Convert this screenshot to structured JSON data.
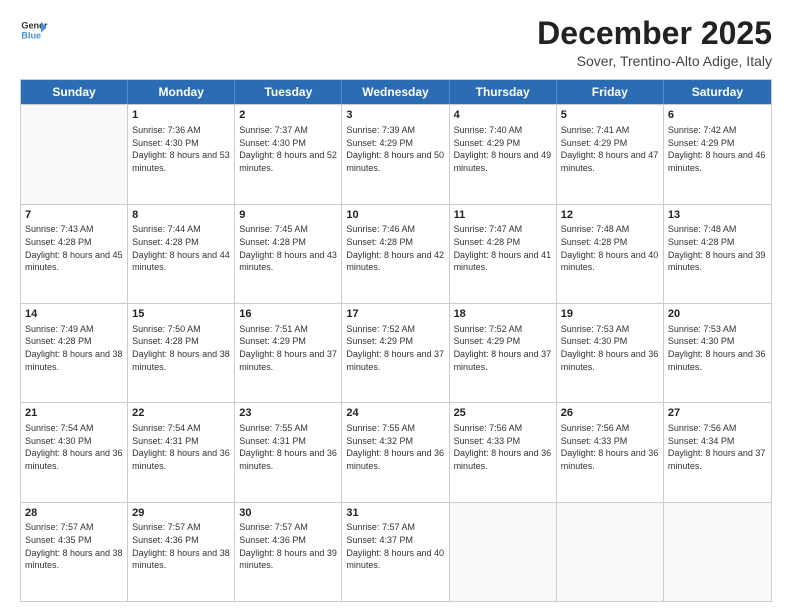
{
  "header": {
    "logo_line1": "General",
    "logo_line2": "Blue",
    "main_title": "December 2025",
    "subtitle": "Sover, Trentino-Alto Adige, Italy"
  },
  "days_of_week": [
    "Sunday",
    "Monday",
    "Tuesday",
    "Wednesday",
    "Thursday",
    "Friday",
    "Saturday"
  ],
  "weeks": [
    [
      {
        "day": "",
        "sunrise": "",
        "sunset": "",
        "daylight": ""
      },
      {
        "day": "1",
        "sunrise": "Sunrise: 7:36 AM",
        "sunset": "Sunset: 4:30 PM",
        "daylight": "Daylight: 8 hours and 53 minutes."
      },
      {
        "day": "2",
        "sunrise": "Sunrise: 7:37 AM",
        "sunset": "Sunset: 4:30 PM",
        "daylight": "Daylight: 8 hours and 52 minutes."
      },
      {
        "day": "3",
        "sunrise": "Sunrise: 7:39 AM",
        "sunset": "Sunset: 4:29 PM",
        "daylight": "Daylight: 8 hours and 50 minutes."
      },
      {
        "day": "4",
        "sunrise": "Sunrise: 7:40 AM",
        "sunset": "Sunset: 4:29 PM",
        "daylight": "Daylight: 8 hours and 49 minutes."
      },
      {
        "day": "5",
        "sunrise": "Sunrise: 7:41 AM",
        "sunset": "Sunset: 4:29 PM",
        "daylight": "Daylight: 8 hours and 47 minutes."
      },
      {
        "day": "6",
        "sunrise": "Sunrise: 7:42 AM",
        "sunset": "Sunset: 4:29 PM",
        "daylight": "Daylight: 8 hours and 46 minutes."
      }
    ],
    [
      {
        "day": "7",
        "sunrise": "Sunrise: 7:43 AM",
        "sunset": "Sunset: 4:28 PM",
        "daylight": "Daylight: 8 hours and 45 minutes."
      },
      {
        "day": "8",
        "sunrise": "Sunrise: 7:44 AM",
        "sunset": "Sunset: 4:28 PM",
        "daylight": "Daylight: 8 hours and 44 minutes."
      },
      {
        "day": "9",
        "sunrise": "Sunrise: 7:45 AM",
        "sunset": "Sunset: 4:28 PM",
        "daylight": "Daylight: 8 hours and 43 minutes."
      },
      {
        "day": "10",
        "sunrise": "Sunrise: 7:46 AM",
        "sunset": "Sunset: 4:28 PM",
        "daylight": "Daylight: 8 hours and 42 minutes."
      },
      {
        "day": "11",
        "sunrise": "Sunrise: 7:47 AM",
        "sunset": "Sunset: 4:28 PM",
        "daylight": "Daylight: 8 hours and 41 minutes."
      },
      {
        "day": "12",
        "sunrise": "Sunrise: 7:48 AM",
        "sunset": "Sunset: 4:28 PM",
        "daylight": "Daylight: 8 hours and 40 minutes."
      },
      {
        "day": "13",
        "sunrise": "Sunrise: 7:48 AM",
        "sunset": "Sunset: 4:28 PM",
        "daylight": "Daylight: 8 hours and 39 minutes."
      }
    ],
    [
      {
        "day": "14",
        "sunrise": "Sunrise: 7:49 AM",
        "sunset": "Sunset: 4:28 PM",
        "daylight": "Daylight: 8 hours and 38 minutes."
      },
      {
        "day": "15",
        "sunrise": "Sunrise: 7:50 AM",
        "sunset": "Sunset: 4:28 PM",
        "daylight": "Daylight: 8 hours and 38 minutes."
      },
      {
        "day": "16",
        "sunrise": "Sunrise: 7:51 AM",
        "sunset": "Sunset: 4:29 PM",
        "daylight": "Daylight: 8 hours and 37 minutes."
      },
      {
        "day": "17",
        "sunrise": "Sunrise: 7:52 AM",
        "sunset": "Sunset: 4:29 PM",
        "daylight": "Daylight: 8 hours and 37 minutes."
      },
      {
        "day": "18",
        "sunrise": "Sunrise: 7:52 AM",
        "sunset": "Sunset: 4:29 PM",
        "daylight": "Daylight: 8 hours and 37 minutes."
      },
      {
        "day": "19",
        "sunrise": "Sunrise: 7:53 AM",
        "sunset": "Sunset: 4:30 PM",
        "daylight": "Daylight: 8 hours and 36 minutes."
      },
      {
        "day": "20",
        "sunrise": "Sunrise: 7:53 AM",
        "sunset": "Sunset: 4:30 PM",
        "daylight": "Daylight: 8 hours and 36 minutes."
      }
    ],
    [
      {
        "day": "21",
        "sunrise": "Sunrise: 7:54 AM",
        "sunset": "Sunset: 4:30 PM",
        "daylight": "Daylight: 8 hours and 36 minutes."
      },
      {
        "day": "22",
        "sunrise": "Sunrise: 7:54 AM",
        "sunset": "Sunset: 4:31 PM",
        "daylight": "Daylight: 8 hours and 36 minutes."
      },
      {
        "day": "23",
        "sunrise": "Sunrise: 7:55 AM",
        "sunset": "Sunset: 4:31 PM",
        "daylight": "Daylight: 8 hours and 36 minutes."
      },
      {
        "day": "24",
        "sunrise": "Sunrise: 7:55 AM",
        "sunset": "Sunset: 4:32 PM",
        "daylight": "Daylight: 8 hours and 36 minutes."
      },
      {
        "day": "25",
        "sunrise": "Sunrise: 7:56 AM",
        "sunset": "Sunset: 4:33 PM",
        "daylight": "Daylight: 8 hours and 36 minutes."
      },
      {
        "day": "26",
        "sunrise": "Sunrise: 7:56 AM",
        "sunset": "Sunset: 4:33 PM",
        "daylight": "Daylight: 8 hours and 36 minutes."
      },
      {
        "day": "27",
        "sunrise": "Sunrise: 7:56 AM",
        "sunset": "Sunset: 4:34 PM",
        "daylight": "Daylight: 8 hours and 37 minutes."
      }
    ],
    [
      {
        "day": "28",
        "sunrise": "Sunrise: 7:57 AM",
        "sunset": "Sunset: 4:35 PM",
        "daylight": "Daylight: 8 hours and 38 minutes."
      },
      {
        "day": "29",
        "sunrise": "Sunrise: 7:57 AM",
        "sunset": "Sunset: 4:36 PM",
        "daylight": "Daylight: 8 hours and 38 minutes."
      },
      {
        "day": "30",
        "sunrise": "Sunrise: 7:57 AM",
        "sunset": "Sunset: 4:36 PM",
        "daylight": "Daylight: 8 hours and 39 minutes."
      },
      {
        "day": "31",
        "sunrise": "Sunrise: 7:57 AM",
        "sunset": "Sunset: 4:37 PM",
        "daylight": "Daylight: 8 hours and 40 minutes."
      },
      {
        "day": "",
        "sunrise": "",
        "sunset": "",
        "daylight": ""
      },
      {
        "day": "",
        "sunrise": "",
        "sunset": "",
        "daylight": ""
      },
      {
        "day": "",
        "sunrise": "",
        "sunset": "",
        "daylight": ""
      }
    ]
  ]
}
